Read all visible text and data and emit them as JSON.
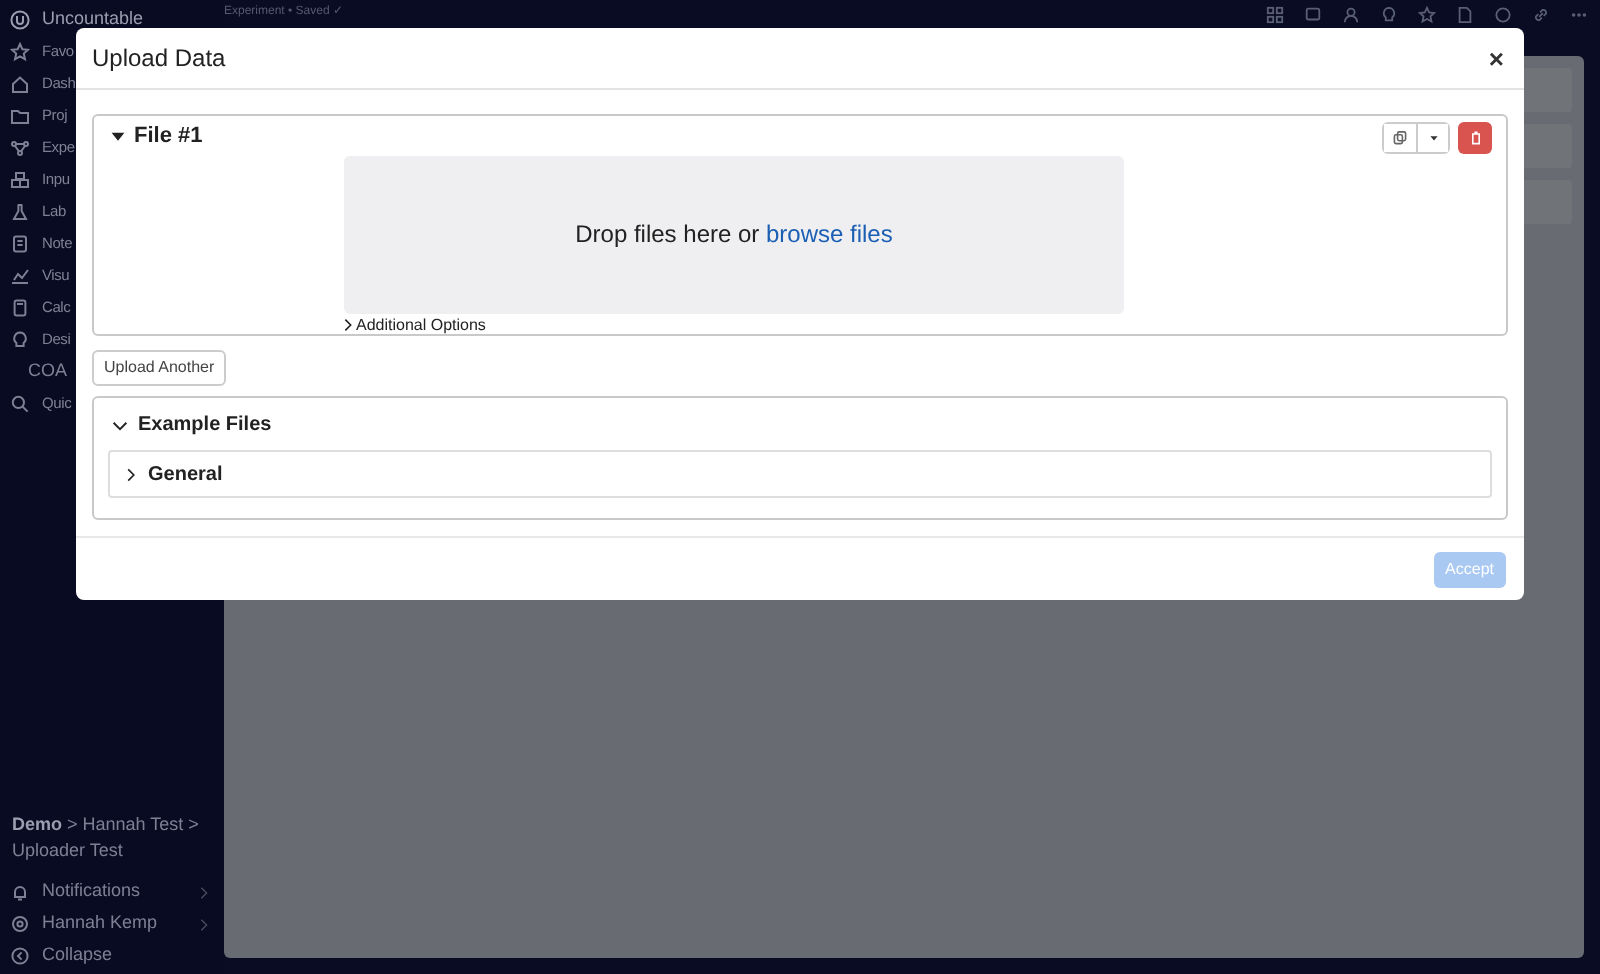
{
  "sidebar": {
    "items": [
      {
        "label": "Uncountable",
        "kind": "logo"
      },
      {
        "label": "Favo",
        "kind": "icon"
      },
      {
        "label": "Dash",
        "kind": "icon"
      },
      {
        "label": "Proj",
        "kind": "icon"
      },
      {
        "label": "Expe",
        "kind": "icon"
      },
      {
        "label": "Inpu",
        "kind": "icon"
      },
      {
        "label": "Lab",
        "kind": "icon"
      },
      {
        "label": "Note",
        "kind": "icon"
      },
      {
        "label": "Visu",
        "kind": "icon"
      },
      {
        "label": "Calc",
        "kind": "icon"
      },
      {
        "label": "Desi",
        "kind": "icon"
      },
      {
        "label": "COA",
        "kind": "plain"
      },
      {
        "label": "Quic",
        "kind": "icon"
      }
    ],
    "breadcrumb": "**Demo** > Hannah Test > Uploader Test",
    "footer_items": [
      {
        "label": "Notifications",
        "has_submenu": true
      },
      {
        "label": "Hannah Kemp",
        "has_submenu": true
      },
      {
        "label": "Collapse",
        "has_submenu": false
      }
    ]
  },
  "top_bar": {
    "status": "Experiment • Saved ✓"
  },
  "modal": {
    "title": "Upload Data",
    "close": "×",
    "files": [
      {
        "title": "File #1",
        "expanded": true,
        "drop_text": "Drop files here or ",
        "drop_link": "browse files",
        "options_label": "Additional Options",
        "options_expanded": false
      }
    ],
    "upload_another": "Upload Another",
    "examples": {
      "title": "Example Files",
      "expanded": true,
      "groups": [
        {
          "title": "General",
          "expanded": false
        }
      ]
    },
    "accept": {
      "label": "Accept",
      "disabled": true
    }
  }
}
